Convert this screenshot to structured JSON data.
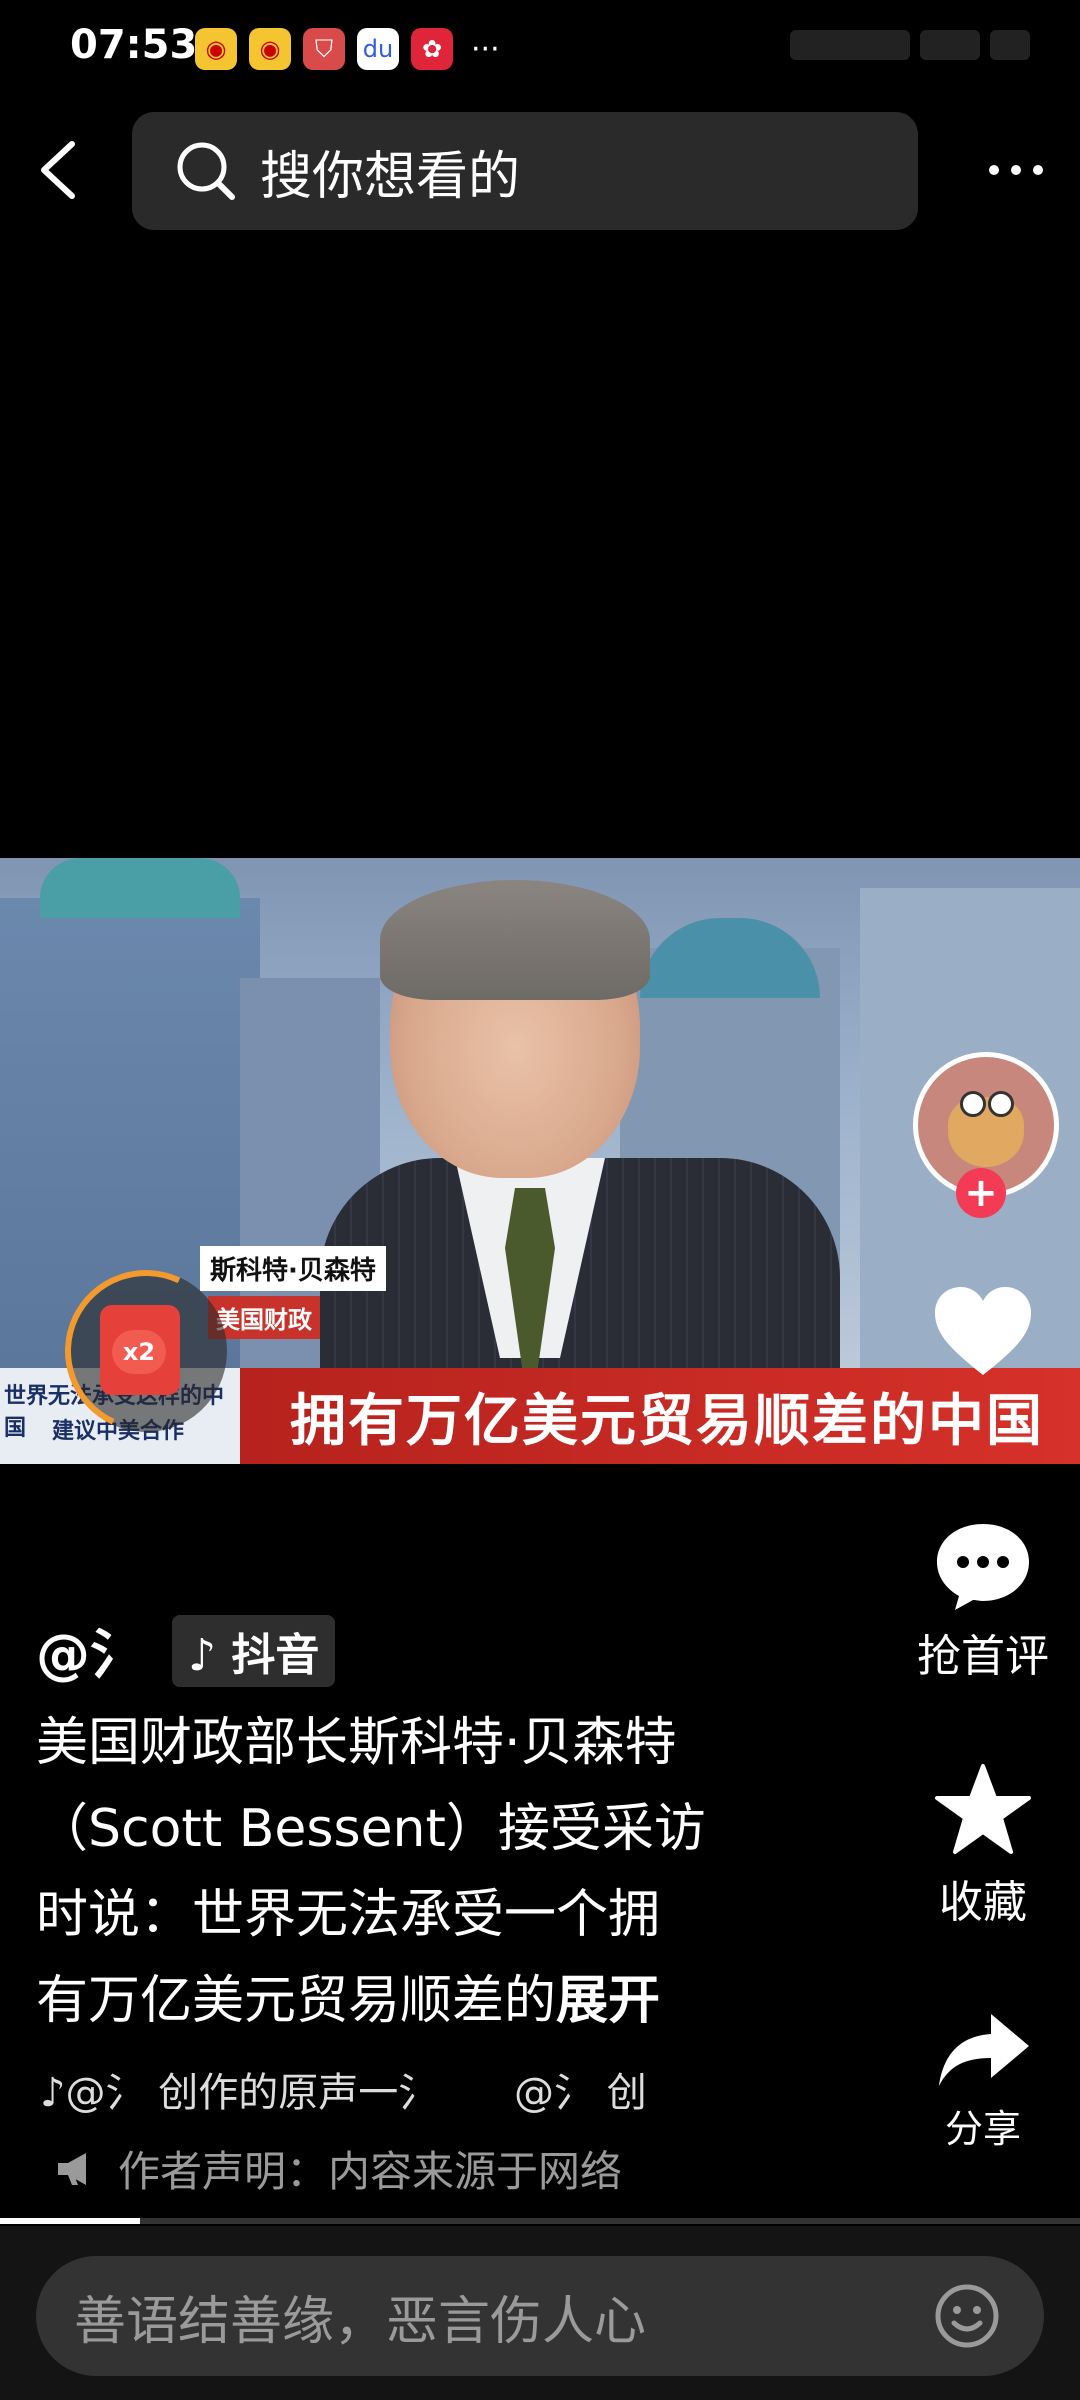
{
  "status_bar": {
    "time": "07:53",
    "icons": [
      "weibo-icon",
      "weibo-icon",
      "shield-app-icon",
      "baidu-icon",
      "red-app-icon"
    ],
    "overflow": "···"
  },
  "top_bar": {
    "search_placeholder": "搜你想看的"
  },
  "video": {
    "name_tag": "斯科特·贝森特",
    "org_tag": "美国财政",
    "lower_left_line1": "世界无法承受这样的中国",
    "lower_left_line2": "建议中美合作",
    "lower_third": "拥有万亿美元贸易顺差的中国"
  },
  "red_packet": {
    "badge": "x2"
  },
  "right_rail": {
    "comment_label": "抢首评",
    "favorite_label": "收藏",
    "share_label": "分享"
  },
  "post": {
    "author": "@氵",
    "platform": "抖音",
    "caption_lines": [
      "美国财政部长斯科特·贝森特",
      "（Scott Bessent）接受采访",
      "时说：世界无法承受一个拥",
      "有万亿美元贸易顺差的"
    ],
    "expand": "展开",
    "music_left": "♪@氵 创作的原声一氵",
    "music_right": "@氵 创",
    "declaration": "作者声明：内容来源于网络"
  },
  "progress": {
    "fraction": 0.13
  },
  "comment_box": {
    "placeholder": "善语结善缘，恶言伤人心"
  },
  "colors": {
    "accent_red": "#f33b55",
    "lower_third_red": "#c7332b",
    "packet_orange": "#f29a2e"
  }
}
